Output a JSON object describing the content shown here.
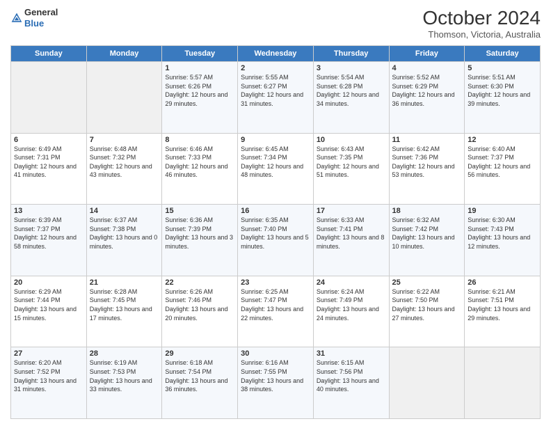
{
  "header": {
    "logo_line1": "General",
    "logo_line2": "Blue",
    "month_title": "October 2024",
    "location": "Thomson, Victoria, Australia"
  },
  "days_of_week": [
    "Sunday",
    "Monday",
    "Tuesday",
    "Wednesday",
    "Thursday",
    "Friday",
    "Saturday"
  ],
  "weeks": [
    [
      {
        "day": "",
        "sunrise": "",
        "sunset": "",
        "daylight": ""
      },
      {
        "day": "",
        "sunrise": "",
        "sunset": "",
        "daylight": ""
      },
      {
        "day": "1",
        "sunrise": "Sunrise: 5:57 AM",
        "sunset": "Sunset: 6:26 PM",
        "daylight": "Daylight: 12 hours and 29 minutes."
      },
      {
        "day": "2",
        "sunrise": "Sunrise: 5:55 AM",
        "sunset": "Sunset: 6:27 PM",
        "daylight": "Daylight: 12 hours and 31 minutes."
      },
      {
        "day": "3",
        "sunrise": "Sunrise: 5:54 AM",
        "sunset": "Sunset: 6:28 PM",
        "daylight": "Daylight: 12 hours and 34 minutes."
      },
      {
        "day": "4",
        "sunrise": "Sunrise: 5:52 AM",
        "sunset": "Sunset: 6:29 PM",
        "daylight": "Daylight: 12 hours and 36 minutes."
      },
      {
        "day": "5",
        "sunrise": "Sunrise: 5:51 AM",
        "sunset": "Sunset: 6:30 PM",
        "daylight": "Daylight: 12 hours and 39 minutes."
      }
    ],
    [
      {
        "day": "6",
        "sunrise": "Sunrise: 6:49 AM",
        "sunset": "Sunset: 7:31 PM",
        "daylight": "Daylight: 12 hours and 41 minutes."
      },
      {
        "day": "7",
        "sunrise": "Sunrise: 6:48 AM",
        "sunset": "Sunset: 7:32 PM",
        "daylight": "Daylight: 12 hours and 43 minutes."
      },
      {
        "day": "8",
        "sunrise": "Sunrise: 6:46 AM",
        "sunset": "Sunset: 7:33 PM",
        "daylight": "Daylight: 12 hours and 46 minutes."
      },
      {
        "day": "9",
        "sunrise": "Sunrise: 6:45 AM",
        "sunset": "Sunset: 7:34 PM",
        "daylight": "Daylight: 12 hours and 48 minutes."
      },
      {
        "day": "10",
        "sunrise": "Sunrise: 6:43 AM",
        "sunset": "Sunset: 7:35 PM",
        "daylight": "Daylight: 12 hours and 51 minutes."
      },
      {
        "day": "11",
        "sunrise": "Sunrise: 6:42 AM",
        "sunset": "Sunset: 7:36 PM",
        "daylight": "Daylight: 12 hours and 53 minutes."
      },
      {
        "day": "12",
        "sunrise": "Sunrise: 6:40 AM",
        "sunset": "Sunset: 7:37 PM",
        "daylight": "Daylight: 12 hours and 56 minutes."
      }
    ],
    [
      {
        "day": "13",
        "sunrise": "Sunrise: 6:39 AM",
        "sunset": "Sunset: 7:37 PM",
        "daylight": "Daylight: 12 hours and 58 minutes."
      },
      {
        "day": "14",
        "sunrise": "Sunrise: 6:37 AM",
        "sunset": "Sunset: 7:38 PM",
        "daylight": "Daylight: 13 hours and 0 minutes."
      },
      {
        "day": "15",
        "sunrise": "Sunrise: 6:36 AM",
        "sunset": "Sunset: 7:39 PM",
        "daylight": "Daylight: 13 hours and 3 minutes."
      },
      {
        "day": "16",
        "sunrise": "Sunrise: 6:35 AM",
        "sunset": "Sunset: 7:40 PM",
        "daylight": "Daylight: 13 hours and 5 minutes."
      },
      {
        "day": "17",
        "sunrise": "Sunrise: 6:33 AM",
        "sunset": "Sunset: 7:41 PM",
        "daylight": "Daylight: 13 hours and 8 minutes."
      },
      {
        "day": "18",
        "sunrise": "Sunrise: 6:32 AM",
        "sunset": "Sunset: 7:42 PM",
        "daylight": "Daylight: 13 hours and 10 minutes."
      },
      {
        "day": "19",
        "sunrise": "Sunrise: 6:30 AM",
        "sunset": "Sunset: 7:43 PM",
        "daylight": "Daylight: 13 hours and 12 minutes."
      }
    ],
    [
      {
        "day": "20",
        "sunrise": "Sunrise: 6:29 AM",
        "sunset": "Sunset: 7:44 PM",
        "daylight": "Daylight: 13 hours and 15 minutes."
      },
      {
        "day": "21",
        "sunrise": "Sunrise: 6:28 AM",
        "sunset": "Sunset: 7:45 PM",
        "daylight": "Daylight: 13 hours and 17 minutes."
      },
      {
        "day": "22",
        "sunrise": "Sunrise: 6:26 AM",
        "sunset": "Sunset: 7:46 PM",
        "daylight": "Daylight: 13 hours and 20 minutes."
      },
      {
        "day": "23",
        "sunrise": "Sunrise: 6:25 AM",
        "sunset": "Sunset: 7:47 PM",
        "daylight": "Daylight: 13 hours and 22 minutes."
      },
      {
        "day": "24",
        "sunrise": "Sunrise: 6:24 AM",
        "sunset": "Sunset: 7:49 PM",
        "daylight": "Daylight: 13 hours and 24 minutes."
      },
      {
        "day": "25",
        "sunrise": "Sunrise: 6:22 AM",
        "sunset": "Sunset: 7:50 PM",
        "daylight": "Daylight: 13 hours and 27 minutes."
      },
      {
        "day": "26",
        "sunrise": "Sunrise: 6:21 AM",
        "sunset": "Sunset: 7:51 PM",
        "daylight": "Daylight: 13 hours and 29 minutes."
      }
    ],
    [
      {
        "day": "27",
        "sunrise": "Sunrise: 6:20 AM",
        "sunset": "Sunset: 7:52 PM",
        "daylight": "Daylight: 13 hours and 31 minutes."
      },
      {
        "day": "28",
        "sunrise": "Sunrise: 6:19 AM",
        "sunset": "Sunset: 7:53 PM",
        "daylight": "Daylight: 13 hours and 33 minutes."
      },
      {
        "day": "29",
        "sunrise": "Sunrise: 6:18 AM",
        "sunset": "Sunset: 7:54 PM",
        "daylight": "Daylight: 13 hours and 36 minutes."
      },
      {
        "day": "30",
        "sunrise": "Sunrise: 6:16 AM",
        "sunset": "Sunset: 7:55 PM",
        "daylight": "Daylight: 13 hours and 38 minutes."
      },
      {
        "day": "31",
        "sunrise": "Sunrise: 6:15 AM",
        "sunset": "Sunset: 7:56 PM",
        "daylight": "Daylight: 13 hours and 40 minutes."
      },
      {
        "day": "",
        "sunrise": "",
        "sunset": "",
        "daylight": ""
      },
      {
        "day": "",
        "sunrise": "",
        "sunset": "",
        "daylight": ""
      }
    ]
  ]
}
